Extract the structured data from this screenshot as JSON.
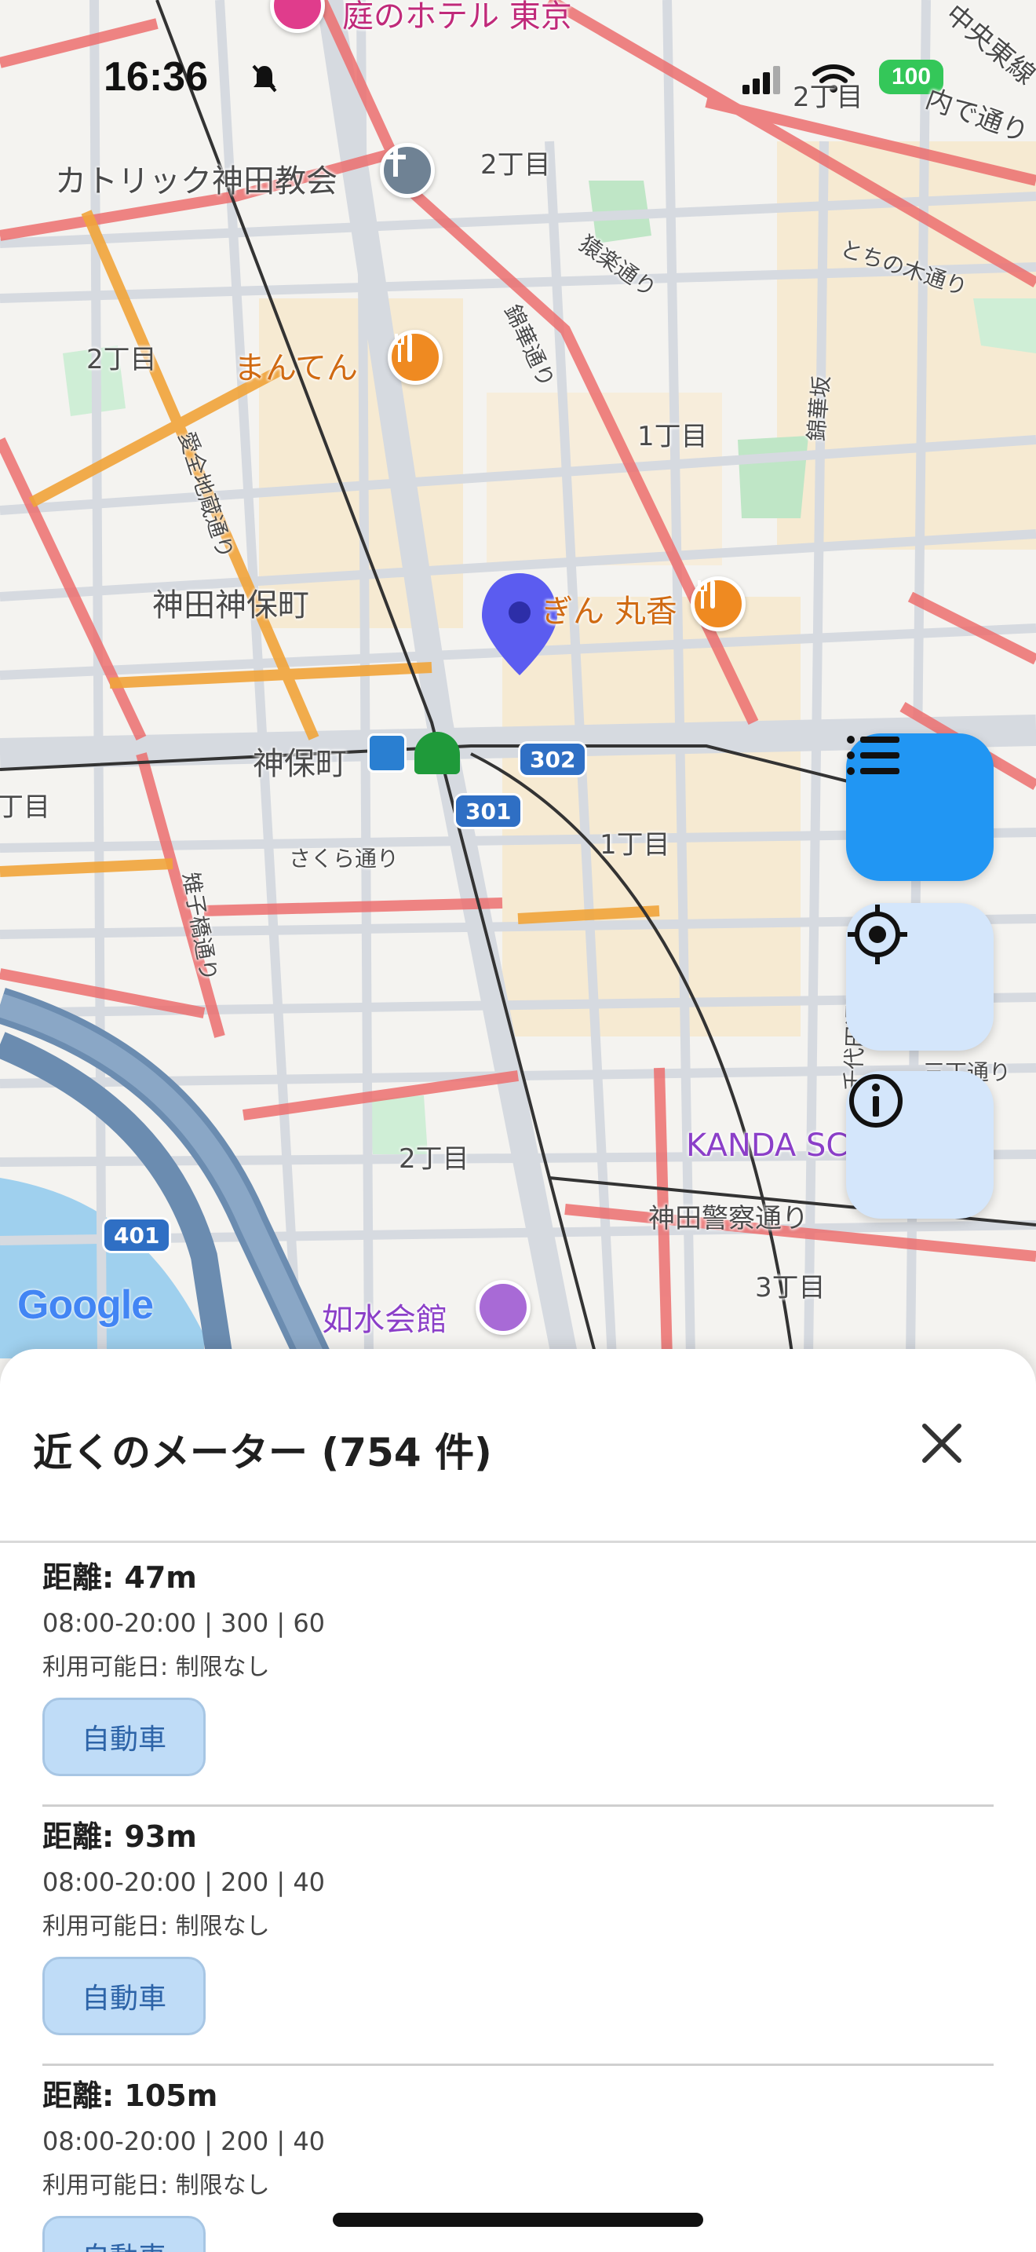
{
  "status_bar": {
    "time": "16:36",
    "battery": "100"
  },
  "map": {
    "labels": {
      "hotel": "庭のホテル 東京",
      "chuo_line": "中央東線",
      "church": "カトリック神田教会",
      "chome2_top": "2丁目",
      "chome2_top_right": "2丁目",
      "sarugaku": "猿楽通り",
      "tochinoki": "とちの木通り",
      "kinka": "錦華通り",
      "kinka_slope": "錦華坂",
      "chome2_left": "2丁目",
      "manten": "まんてん",
      "chome1_mid": "1丁目",
      "jizo": "愛全地蔵通り",
      "jimbocho_area": "神田神保町",
      "marukou": "ぎん 丸香",
      "jimbocho_station": "神保町",
      "chome_left_edge": "丁目",
      "sakura": "さくら通り",
      "chome1_low": "1丁目",
      "zoshigaya": "雉子橋通り",
      "chiyoda": "千代田通り",
      "kanda_school": "KANDA SC    AL",
      "chome2_low": "2丁目",
      "police": "神田警察通り",
      "chome3": "3丁目",
      "josuikaikan": "如水会館",
      "sanchome_street": "三丁通り",
      "uchi_kanda": "内で通り"
    },
    "shields": {
      "r302": "302",
      "r301": "301",
      "r401": "401"
    },
    "attribution": "Google"
  },
  "fabs": {
    "list_icon": "list-icon",
    "locate_icon": "crosshair-icon",
    "info_icon": "info-icon"
  },
  "sheet": {
    "title": "近くのメーター (754 件)",
    "items": [
      {
        "distance": "距離: 47m",
        "hours": "08:00-20:00 | 300 | 60",
        "availability": "利用可能日: 制限なし",
        "tag": "自動車"
      },
      {
        "distance": "距離: 93m",
        "hours": "08:00-20:00 | 200 | 40",
        "availability": "利用可能日: 制限なし",
        "tag": "自動車"
      },
      {
        "distance": "距離: 105m",
        "hours": "08:00-20:00 | 200 | 40",
        "availability": "利用可能日: 制限なし",
        "tag": "自動車"
      }
    ]
  },
  "colors": {
    "accent": "#2196f3",
    "tag_bg": "#bfdcf7",
    "pin": "#5b5cf0"
  }
}
